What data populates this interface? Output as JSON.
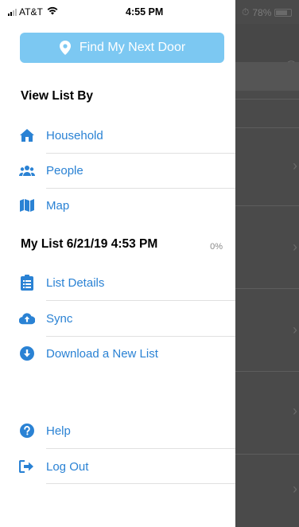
{
  "status_bar": {
    "carrier": "AT&T",
    "time": "4:55 PM",
    "battery": "78%"
  },
  "find_button": {
    "label": "Find My Next Door",
    "icon": "map-pin-icon"
  },
  "view_list": {
    "heading": "View List By",
    "items": [
      {
        "label": "Household",
        "icon": "home-icon"
      },
      {
        "label": "People",
        "icon": "users-icon"
      },
      {
        "label": "Map",
        "icon": "map-icon"
      }
    ]
  },
  "my_list": {
    "heading": "My List 6/21/19 4:53 PM",
    "progress": "0%",
    "items": [
      {
        "label": "List Details",
        "icon": "clipboard-list-icon"
      },
      {
        "label": "Sync",
        "icon": "cloud-upload-icon"
      },
      {
        "label": "Download a New List",
        "icon": "download-circle-icon"
      }
    ]
  },
  "footer_items": [
    {
      "label": "Help",
      "icon": "question-circle-icon"
    },
    {
      "label": "Log Out",
      "icon": "sign-out-icon"
    }
  ],
  "colors": {
    "accent": "#2a82d4",
    "button": "#7cc8f2",
    "overlay": "#4a4a4a"
  }
}
